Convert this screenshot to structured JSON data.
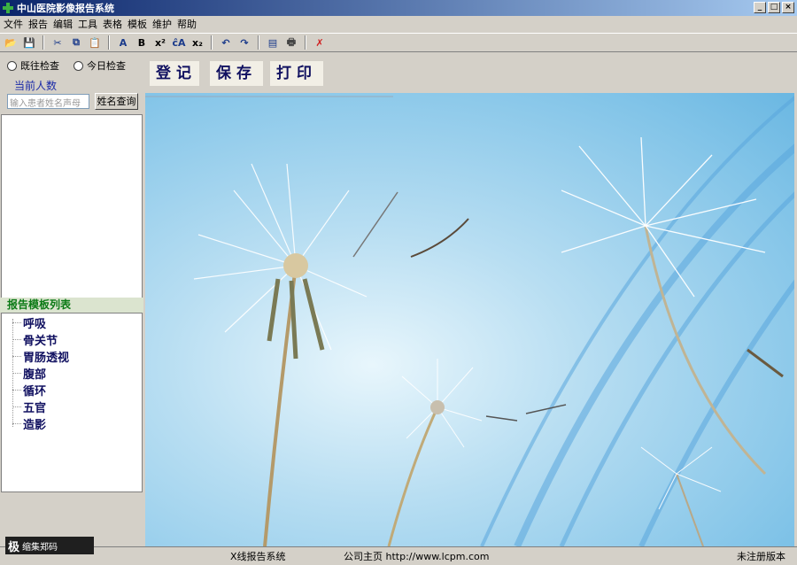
{
  "window": {
    "title": "中山医院影像报告系统",
    "controls": [
      "_",
      "□",
      "×"
    ]
  },
  "menu": [
    "文件",
    "报告",
    "编辑",
    "工具",
    "表格",
    "模板",
    "维护",
    "帮助"
  ],
  "toolbar": {
    "icons": [
      "open-folder-icon",
      "save-icon",
      "cut-icon",
      "copy-icon",
      "paste-icon",
      "font-icon",
      "bold-icon",
      "superscript-icon",
      "font-size-icon",
      "subscript-icon",
      "undo-icon",
      "redo-icon",
      "preview-icon",
      "print-icon",
      "exit-icon"
    ],
    "glyphs": [
      "📂",
      "💾",
      "✂",
      "⧉",
      "📋",
      "A",
      "B",
      "x²",
      "ĉA",
      "x₂",
      "↶",
      "↷",
      "▤",
      "🖶",
      "✗"
    ]
  },
  "left": {
    "radio_history": "既往检查",
    "radio_today": "今日检查",
    "count_label": "当前人数",
    "search_placeholder": "输入患者姓名声母",
    "search_button": "姓名查询"
  },
  "templates": {
    "header": "报告模板列表",
    "items": [
      "呼吸",
      "骨关节",
      "胃肠透视",
      "腹部",
      "循环",
      "五官",
      "造影"
    ]
  },
  "actions": {
    "register": "登记",
    "save": "保存",
    "print": "打印"
  },
  "status": {
    "cell1": "X线报告系统",
    "cell2": "公司主页  http://www.lcpm.com",
    "cell3": "未注册版本"
  },
  "logo": {
    "char": "极",
    "text": "缩集郑码"
  }
}
